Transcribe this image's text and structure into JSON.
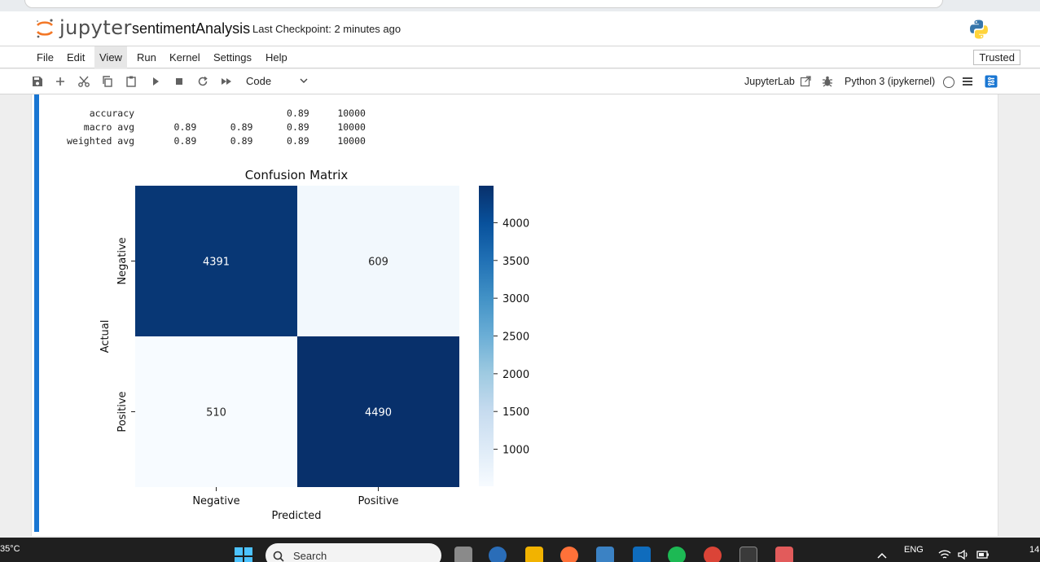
{
  "header": {
    "logo_text": "jupyter",
    "notebook_name": "sentimentAnalysis",
    "checkpoint": "Last Checkpoint: 2 minutes ago"
  },
  "menu": {
    "items": [
      "File",
      "Edit",
      "View",
      "Run",
      "Kernel",
      "Settings",
      "Help"
    ],
    "active": "View",
    "trusted": "Trusted"
  },
  "toolbar": {
    "cell_type": "Code",
    "jupyterlab_label": "JupyterLab",
    "kernel_label": "Python 3 (ipykernel)"
  },
  "report": {
    "rows": [
      "    accuracy                           0.89     10000",
      "   macro avg       0.89      0.89      0.89     10000",
      "weighted avg       0.89      0.89      0.89     10000"
    ]
  },
  "chart_data": {
    "type": "heatmap",
    "title": "Confusion Matrix",
    "xlabel": "Predicted",
    "ylabel": "Actual",
    "x_categories": [
      "Negative",
      "Positive"
    ],
    "y_categories": [
      "Negative",
      "Positive"
    ],
    "values": [
      [
        4391,
        609
      ],
      [
        510,
        4490
      ]
    ],
    "colormap": "Blues",
    "vmin": 510,
    "vmax": 4490,
    "colorbar_ticks": [
      4000,
      3500,
      3000,
      2500,
      2000,
      1500,
      1000
    ],
    "colorbar_ticklabels": [
      "4000",
      "3500",
      "3000",
      "2500",
      "2000",
      "1500",
      "1000"
    ]
  },
  "taskbar": {
    "temperature": "35°C",
    "search_placeholder": "Search",
    "language": "ENG",
    "clock": "14"
  },
  "colors": {
    "jupyter_orange": "#f37726",
    "accent_blue": "#1976d2",
    "heat_low": "#f7fbff",
    "heat_high": "#08306b"
  }
}
